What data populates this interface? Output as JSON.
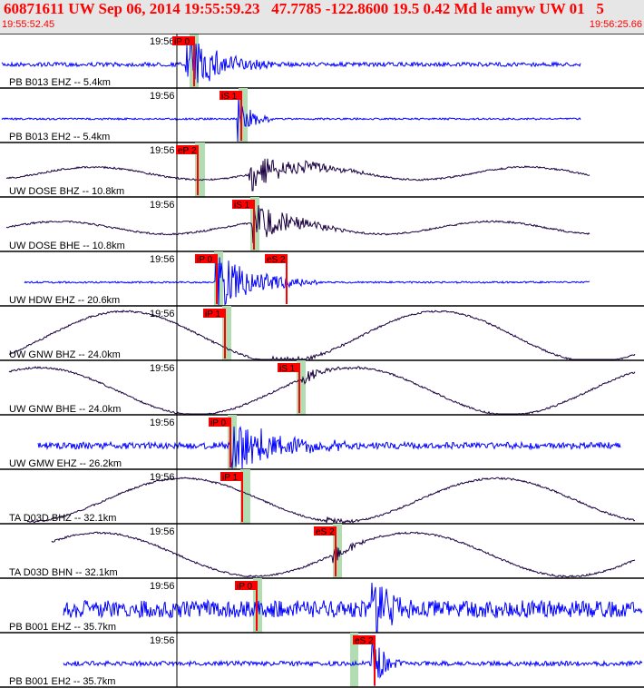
{
  "header": {
    "title": "60871611 UW Sep 06, 2014 19:55:59.23   47.7785 -122.8600 19.5 0.42 Md le amyw UW 01   5",
    "start_time": "19:55:52.45",
    "end_time": "19:56:25.66"
  },
  "chart_data": {
    "type": "seismogram",
    "time_window": [
      "19:55:52.45",
      "19:56:25.66"
    ],
    "colors": {
      "header_bg": "#e6e6e6",
      "header_text": "#ff0000",
      "pick": "#ff0000",
      "pick_window": "#b2dcb2",
      "trace_blue": "#0000ff",
      "trace_dark": "#1a0040",
      "divider": "#000000"
    },
    "traces": [
      {
        "label": "PB B013 EHZ --  5.4km",
        "minute_tick": "19:56",
        "color": "blue",
        "kind": "noise",
        "picks": [
          {
            "label": "iP 0"
          }
        ]
      },
      {
        "label": "PB B013 EH2 --  5.4km",
        "minute_tick": "19:56",
        "color": "blue",
        "kind": "flat",
        "picks": [
          {
            "label": "iS 1"
          }
        ]
      },
      {
        "label": "UW DOSE BHZ --  10.8km",
        "minute_tick": "19:56",
        "color": "dark",
        "kind": "wave",
        "picks": [
          {
            "label": "eP 2"
          }
        ]
      },
      {
        "label": "UW DOSE BHE --  10.8km",
        "minute_tick": "19:56",
        "color": "dark",
        "kind": "wave",
        "picks": [
          {
            "label": "iS 1"
          }
        ]
      },
      {
        "label": "UW HDW EHZ --  20.6km",
        "minute_tick": "19:56",
        "color": "blue",
        "kind": "flat",
        "picks": [
          {
            "label": "iP 0"
          },
          {
            "label": "eS 2"
          }
        ]
      },
      {
        "label": "UW GNW BHZ --  24.0km",
        "minute_tick": "19:56",
        "color": "dark",
        "kind": "big",
        "picks": [
          {
            "label": "iP 1"
          }
        ]
      },
      {
        "label": "UW GNW BHE --  24.0km",
        "minute_tick": "19:56",
        "color": "dark",
        "kind": "big",
        "picks": [
          {
            "label": "iS 1"
          }
        ]
      },
      {
        "label": "UW GMW EHZ --  26.2km",
        "minute_tick": "19:56",
        "color": "blue",
        "kind": "noise",
        "picks": [
          {
            "label": "iP 0"
          }
        ]
      },
      {
        "label": "TA D03D BHZ --  32.1km",
        "minute_tick": "19:56",
        "color": "dark",
        "kind": "big",
        "picks": [
          {
            "label": "iP 1"
          }
        ]
      },
      {
        "label": "TA D03D BHN --  32.1km",
        "minute_tick": "19:56",
        "color": "dark",
        "kind": "big",
        "picks": [
          {
            "label": "eS 2"
          }
        ]
      },
      {
        "label": "PB B001 EHZ --  35.7km",
        "minute_tick": "19:56",
        "color": "blue",
        "kind": "noisy",
        "picks": [
          {
            "label": "iP 0"
          }
        ]
      },
      {
        "label": "PB B001 EH2 --  35.7km",
        "minute_tick": "19:56",
        "color": "blue",
        "kind": "flat",
        "picks": [
          {
            "label": "eS 2"
          }
        ]
      }
    ]
  }
}
